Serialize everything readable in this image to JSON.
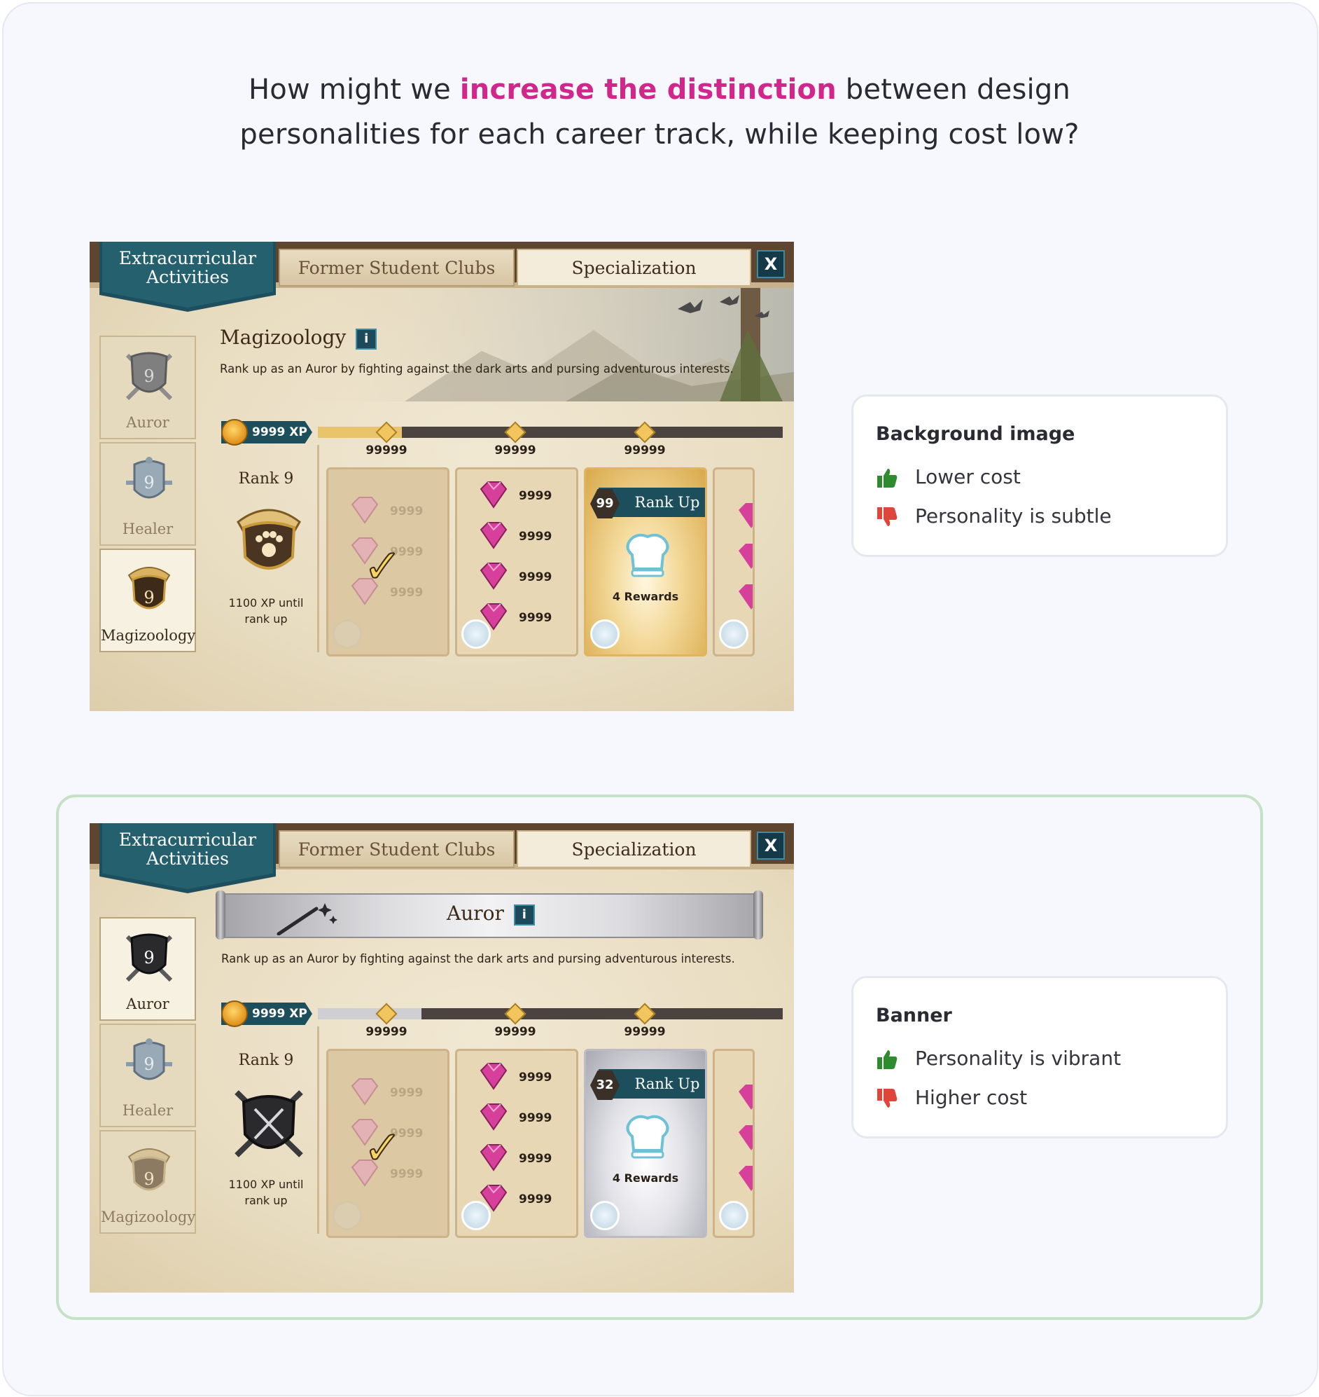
{
  "headline": {
    "before": "How might we ",
    "highlight": "increase the distinction",
    "after_line1": " between design",
    "line2": "personalities for each career track, while keeping cost low?"
  },
  "game_ui": {
    "ribbon_line1": "Extracurricular",
    "ribbon_line2": "Activities",
    "tab_former": "Former Student Clubs",
    "tab_specialization": "Specialization",
    "close_label": "X",
    "info_label": "i",
    "description": "Rank up as an Auror by fighting against the dark arts and pursing adventurous interests.",
    "xp_label": "9999 XP",
    "milestones": [
      "99999",
      "99999",
      "99999"
    ],
    "rank_label": "Rank 9",
    "xp_until_line1": "1100 XP until",
    "xp_until_line2": "rank up",
    "gem_value": "9999",
    "rank_up_label": "Rank Up",
    "rewards_label": "4 Rewards",
    "tracks": [
      {
        "name": "Auror",
        "level": "9"
      },
      {
        "name": "Healer",
        "level": "9"
      },
      {
        "name": "Magizoology",
        "level": "9"
      }
    ]
  },
  "variant_a": {
    "section_title": "Magizoology",
    "active_track": "Magizoology",
    "rank_up_level": "99",
    "accent": "#e1b462"
  },
  "variant_b": {
    "section_title": "Auror",
    "active_track": "Auror",
    "rank_up_level": "32",
    "accent": "#bcbcc4"
  },
  "options": [
    {
      "title": "Background image",
      "pro": "Lower cost",
      "con": "Personality is subtle",
      "selected": false
    },
    {
      "title": "Banner",
      "pro": "Personality is vibrant",
      "con": "Higher cost",
      "selected": true
    }
  ],
  "colors": {
    "highlight_text": "#d1278d",
    "thumbs_up": "#2e8b2e",
    "thumbs_down": "#e0453a",
    "selected_frame": "#c6e1c6"
  }
}
